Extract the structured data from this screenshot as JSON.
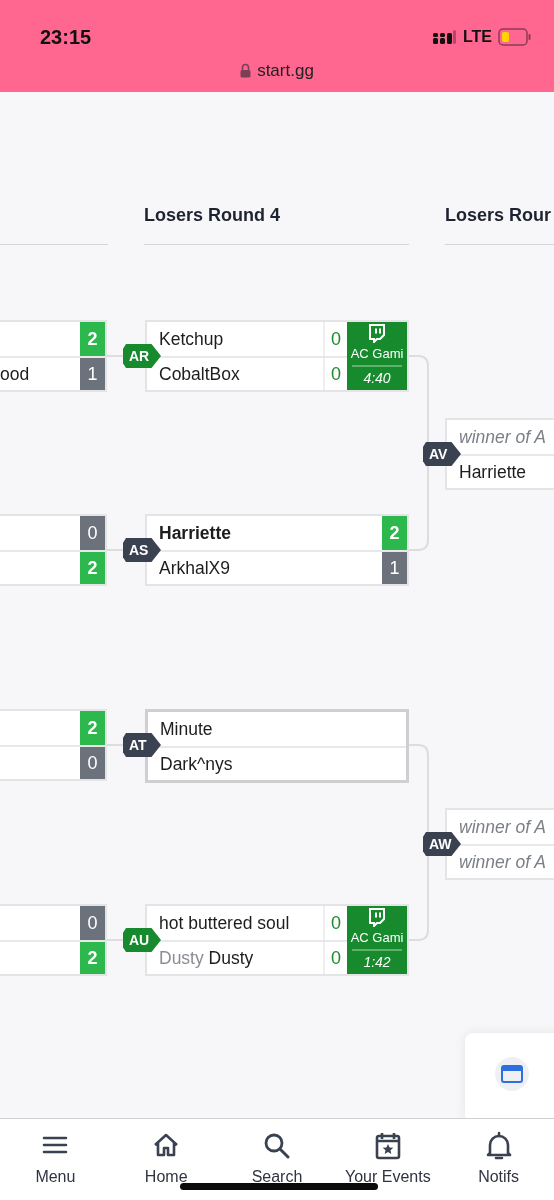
{
  "status_bar": {
    "time": "23:15",
    "network": "LTE",
    "url": "start.gg"
  },
  "columns": [
    {
      "matches": [
        {
          "live": false,
          "entries": [
            {
              "score": "2",
              "winner": true
            },
            {
              "name": "ood",
              "score": "1",
              "winner": false
            }
          ]
        },
        {
          "live": false,
          "entries": [
            {
              "score": "0",
              "winner": false
            },
            {
              "score": "2",
              "winner": true
            }
          ]
        },
        {
          "live": false,
          "entries": [
            {
              "score": "2",
              "winner": true
            },
            {
              "score": "0",
              "winner": false
            }
          ]
        },
        {
          "live": false,
          "entries": [
            {
              "score": "0",
              "winner": false
            },
            {
              "score": "2",
              "winner": true
            }
          ]
        }
      ]
    },
    {
      "title": "Losers Round 4",
      "matches": [
        {
          "label": "AR",
          "live": true,
          "ready": false,
          "entries": [
            {
              "name": "Ketchup",
              "score": "0",
              "winner": false
            },
            {
              "name": "CobaltBox",
              "score": "0",
              "winner": false
            }
          ],
          "stream": {
            "channel": "AC Gami",
            "time": "4:40"
          }
        },
        {
          "label": "AS",
          "live": false,
          "ready": false,
          "entries": [
            {
              "name": "Harriette",
              "score": "2",
              "winner": true
            },
            {
              "name": "ArkhalX9",
              "score": "1",
              "winner": false
            }
          ]
        },
        {
          "label": "AT",
          "live": false,
          "ready": true,
          "entries": [
            {
              "name": "Minute",
              "winner": false
            },
            {
              "name": "Dark^nys",
              "winner": false
            }
          ]
        },
        {
          "label": "AU",
          "live": true,
          "ready": false,
          "entries": [
            {
              "name": "hot buttered soul",
              "score": "0",
              "winner": false
            },
            {
              "prefix": "Dusty",
              "name": "Dusty",
              "score": "0",
              "winner": false
            }
          ],
          "stream": {
            "channel": "AC Gami",
            "time": "1:42"
          }
        }
      ]
    },
    {
      "title": "Losers Rour",
      "matches": [
        {
          "label": "AV",
          "live": false,
          "entries": [
            {
              "name": "winner of A",
              "placeholder": true,
              "winner": false
            },
            {
              "name": "Harriette",
              "placeholder": false,
              "winner": false
            }
          ]
        },
        {
          "label": "AW",
          "live": false,
          "entries": [
            {
              "name": "winner of A",
              "placeholder": true,
              "winner": false
            },
            {
              "name": "winner of A",
              "placeholder": true,
              "winner": false
            }
          ]
        }
      ]
    }
  ],
  "nav": [
    {
      "label": "Menu",
      "kind": "menu"
    },
    {
      "label": "Home",
      "kind": "home"
    },
    {
      "label": "Search",
      "kind": "search"
    },
    {
      "label": "Your Events",
      "kind": "events"
    },
    {
      "label": "Notifs",
      "kind": "bell"
    }
  ]
}
